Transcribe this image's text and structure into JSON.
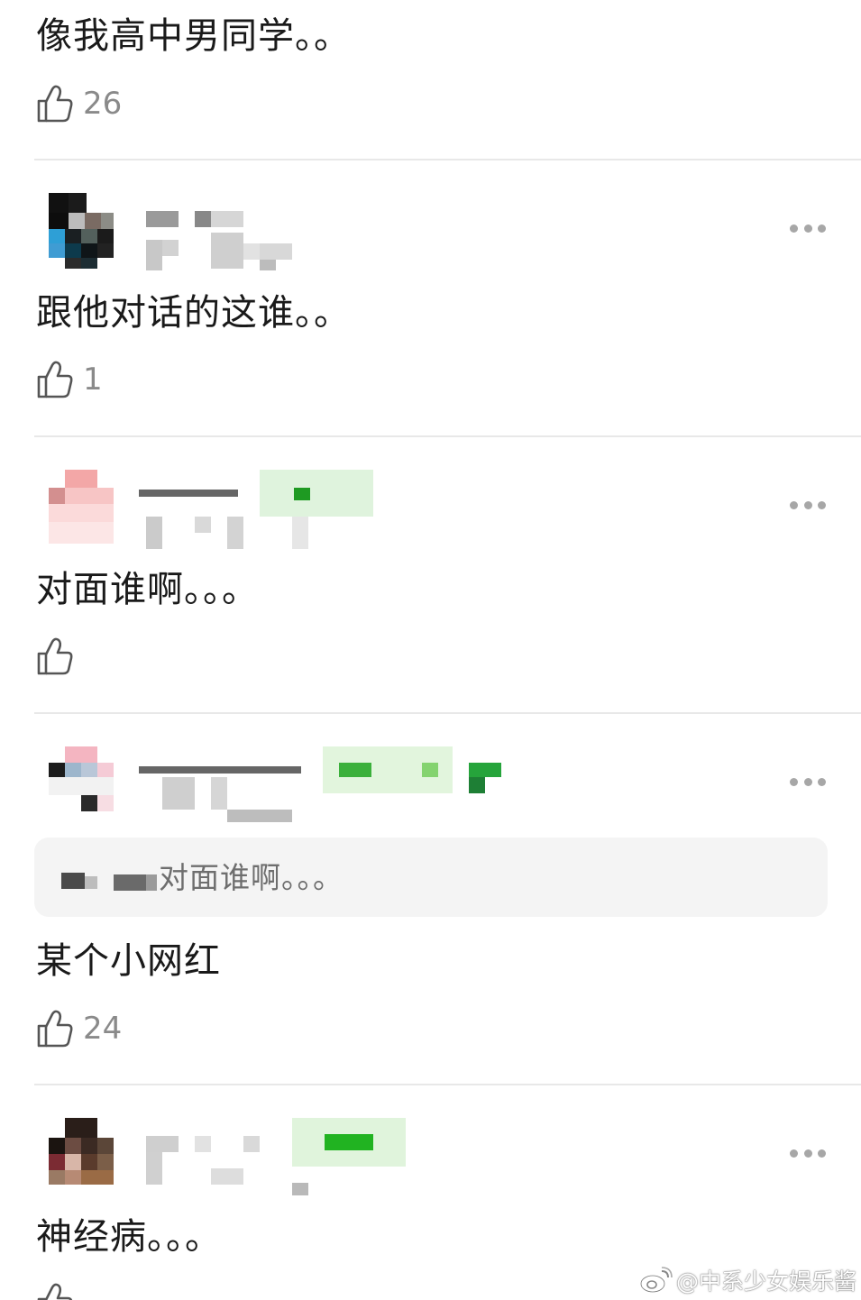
{
  "comments": [
    {
      "text": "像我高中男同学。。",
      "likes": "26"
    },
    {
      "text": "跟他对话的这谁。。",
      "likes": "1"
    },
    {
      "text": "对面谁啊。。。",
      "likes": ""
    },
    {
      "quote": "对面谁啊。。。",
      "text": "某个小网红",
      "likes": "24"
    },
    {
      "text": "神经病。。。",
      "likes": ""
    }
  ],
  "watermark": "@中系少女娱乐酱",
  "icons": {
    "like": "thumbs-up-icon",
    "more": "ellipsis-icon",
    "watermark": "weibo-logo-icon"
  },
  "colors": {
    "text": "#1a1a1a",
    "muted": "#8a8a8a",
    "divider": "#e8e8e8",
    "quote_bg": "#f4f4f4",
    "badge_green": "#2bbd2b"
  }
}
